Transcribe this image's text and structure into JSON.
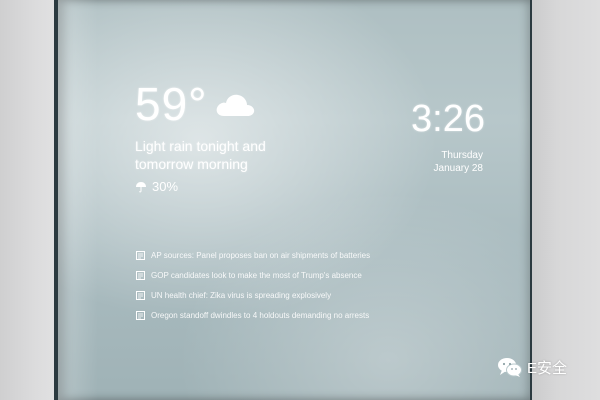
{
  "weather": {
    "temperature": "59°",
    "condition_icon": "cloud-icon",
    "forecast": "Light rain tonight and tomorrow morning",
    "precip_icon": "umbrella-icon",
    "precipitation": "30%"
  },
  "clock": {
    "time": "3:26",
    "day": "Thursday",
    "date": "January 28"
  },
  "news": {
    "item_icon": "news-icon",
    "items": [
      {
        "headline": "AP sources: Panel proposes ban on air shipments of batteries"
      },
      {
        "headline": "GOP candidates look to make the most of Trump's absence"
      },
      {
        "headline": "UN health chief: Zika virus is spreading explosively"
      },
      {
        "headline": "Oregon standoff dwindles to 4 holdouts demanding no arrests"
      }
    ]
  },
  "watermark": {
    "icon": "wechat-icon",
    "label": "E安全"
  },
  "colors": {
    "text": "#ffffff",
    "mirror": "#aebfc2",
    "wall": "#dcdcdd",
    "frame": "#2b3a40"
  }
}
